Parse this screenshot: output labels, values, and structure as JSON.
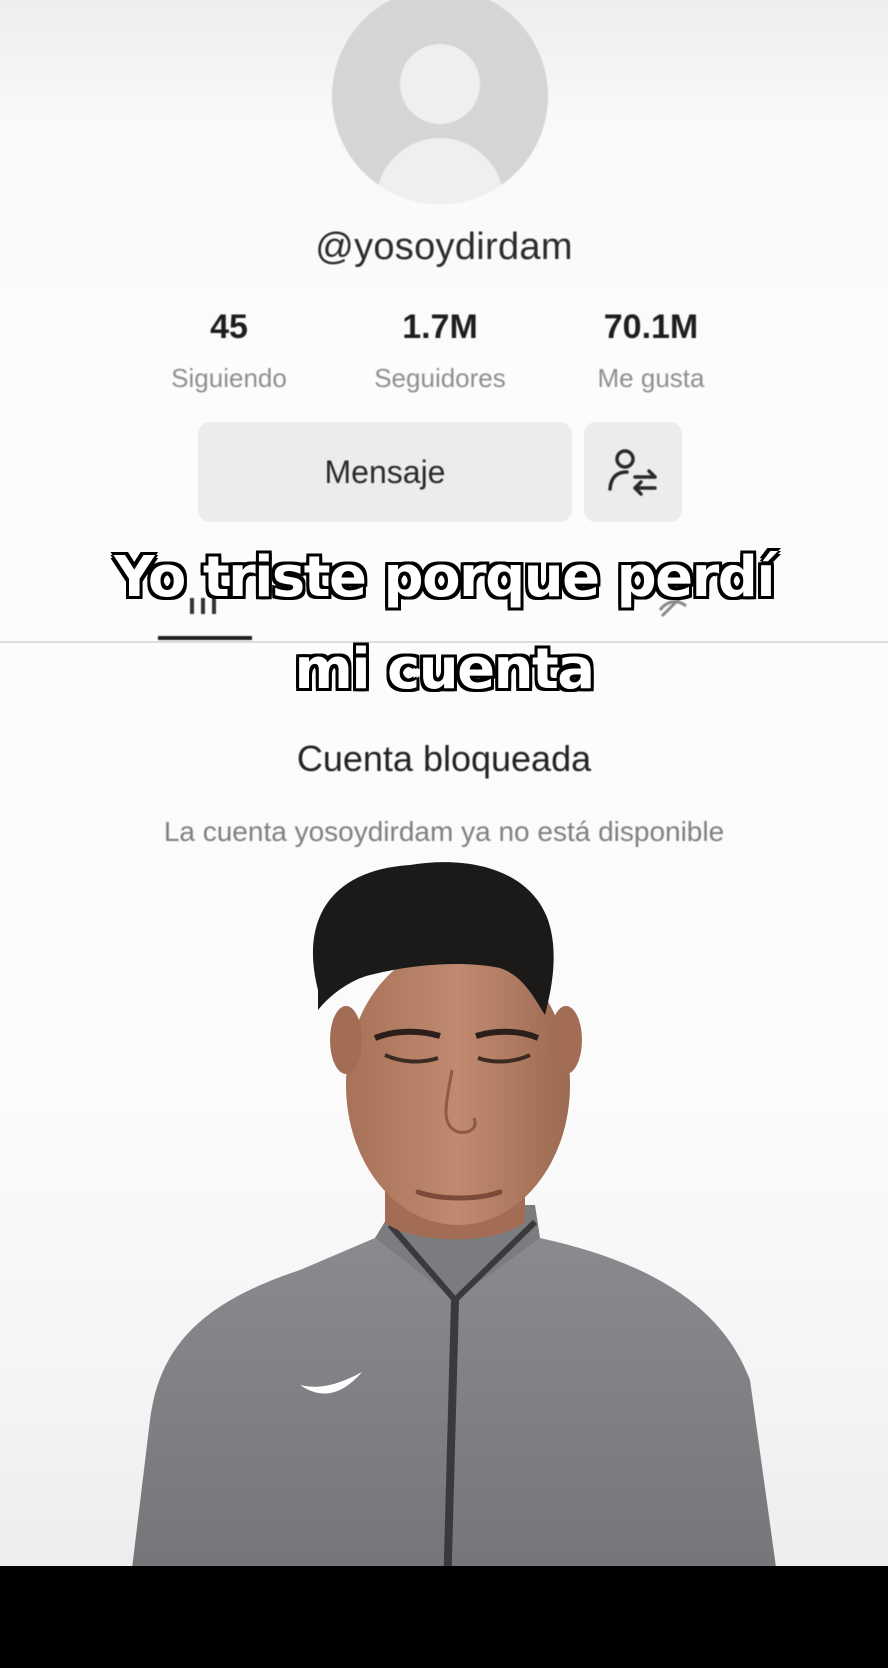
{
  "profile": {
    "username": "@yosoydirdam",
    "stats": [
      {
        "value": "45",
        "label": "Siguiendo"
      },
      {
        "value": "1.7M",
        "label": "Seguidores"
      },
      {
        "value": "70.1M",
        "label": "Me gusta"
      }
    ],
    "message_button": "Mensaje",
    "swap_icon": "user-swap-icon"
  },
  "caption": {
    "line1": "Yo triste porque perdí",
    "line2": "mi cuenta"
  },
  "blocked": {
    "title": "Cuenta bloqueada",
    "subtitle": "La cuenta yosoydirdam ya no está disponible"
  },
  "colors": {
    "background": "#fbfbfb",
    "button_bg": "#ececec",
    "avatar_bg": "#d6d4d6",
    "shirt": "#7d7e82",
    "skin": "#b9836a",
    "hair": "#1c1a19"
  }
}
